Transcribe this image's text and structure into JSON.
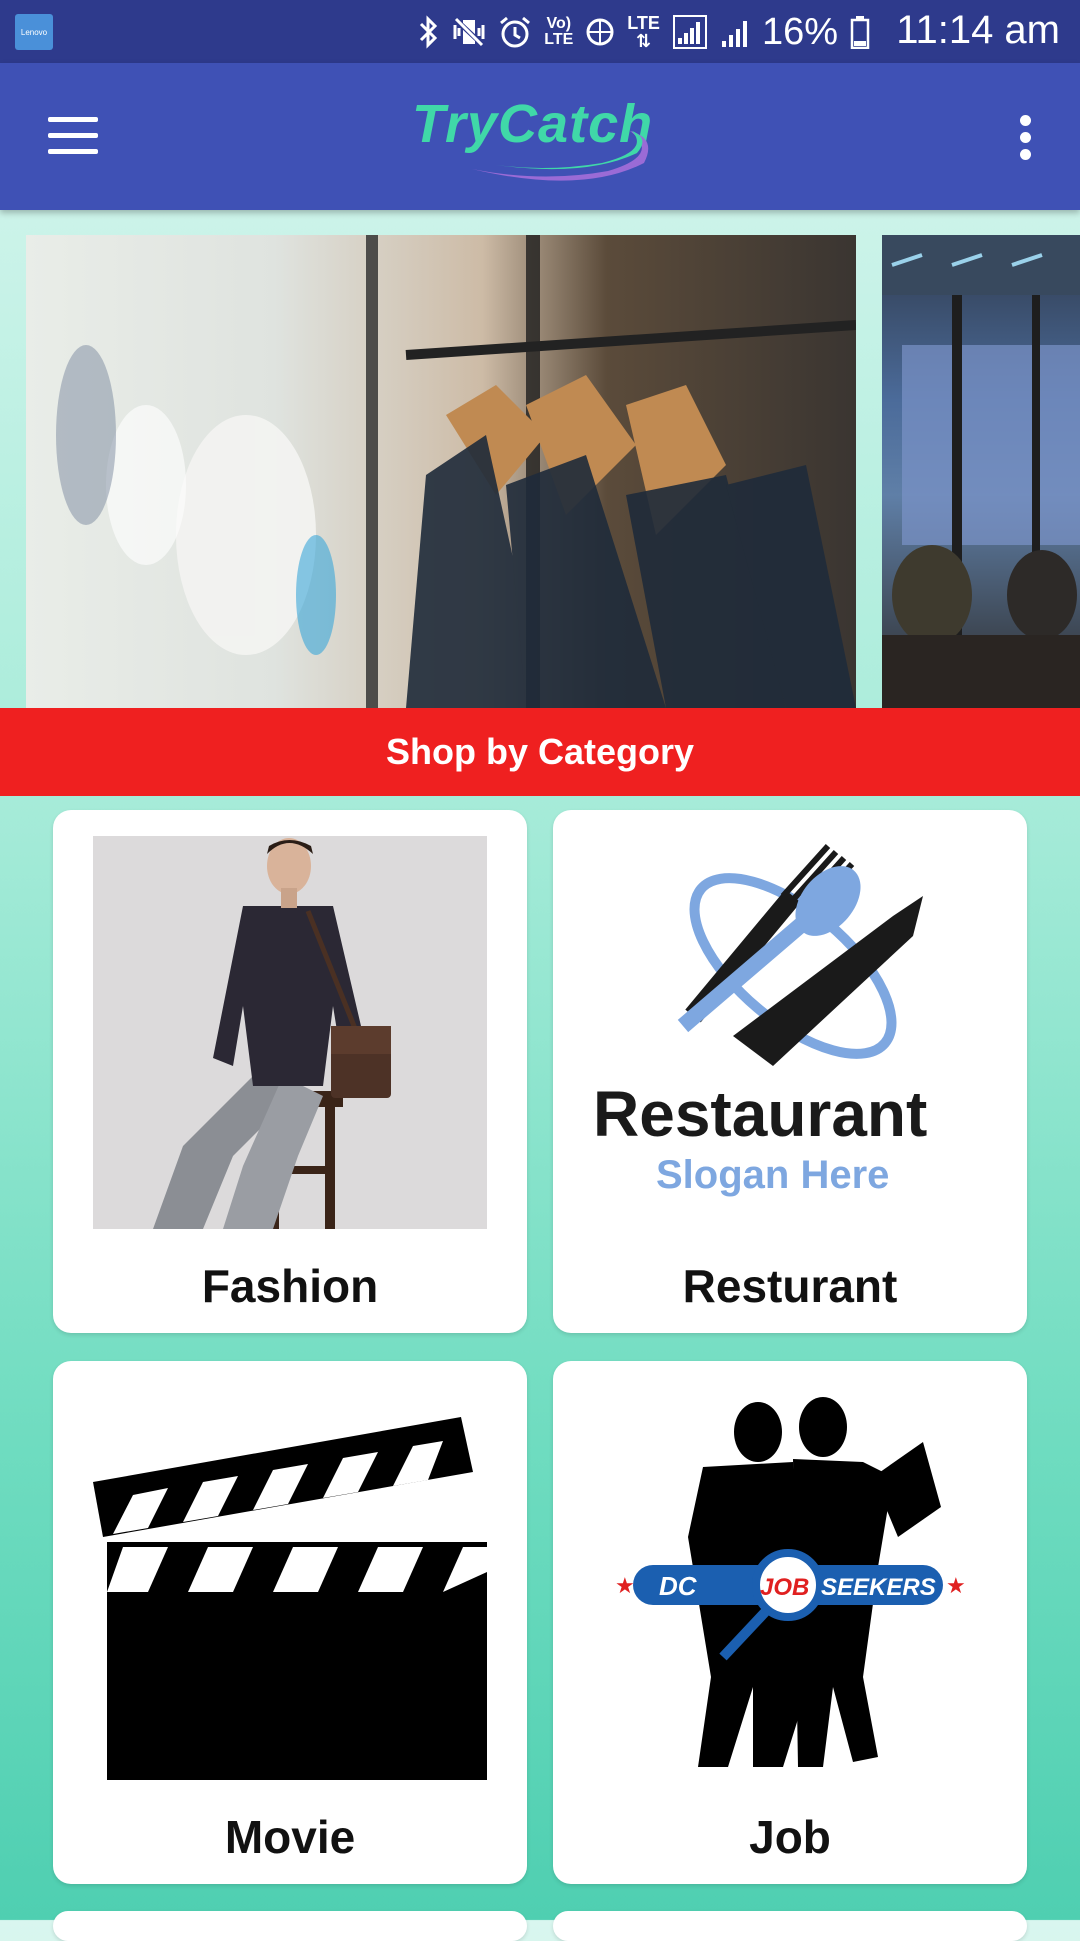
{
  "status_bar": {
    "carrier_brand": "Lenovo",
    "battery_percent": "16%",
    "time": "11:14 am",
    "icons": [
      "bluetooth-icon",
      "vibrate-icon",
      "alarm-icon",
      "volte-icon",
      "data-saver-icon",
      "lte-icon",
      "signal-icon",
      "signal-icon-2",
      "battery-icon"
    ]
  },
  "app_bar": {
    "logo_text": "TryCatch",
    "menu_icon": "hamburger-menu-icon",
    "overflow_icon": "more-vert-icon",
    "color": "#3f51b5"
  },
  "carousel": {
    "slides": [
      {
        "name": "clothing-rack-slide"
      },
      {
        "name": "restaurant-interior-slide"
      }
    ]
  },
  "section": {
    "title": "Shop by Category",
    "banner_color": "#ef2020"
  },
  "categories": [
    {
      "label": "Fashion"
    },
    {
      "label": "Resturant",
      "logo_title": "Restaurant",
      "logo_slogan": "Slogan Here"
    },
    {
      "label": "Movie"
    },
    {
      "label": "Job",
      "logo_text_dc": "DC",
      "logo_text_job": "JOB",
      "logo_text_seekers": "SEEKERS"
    }
  ]
}
